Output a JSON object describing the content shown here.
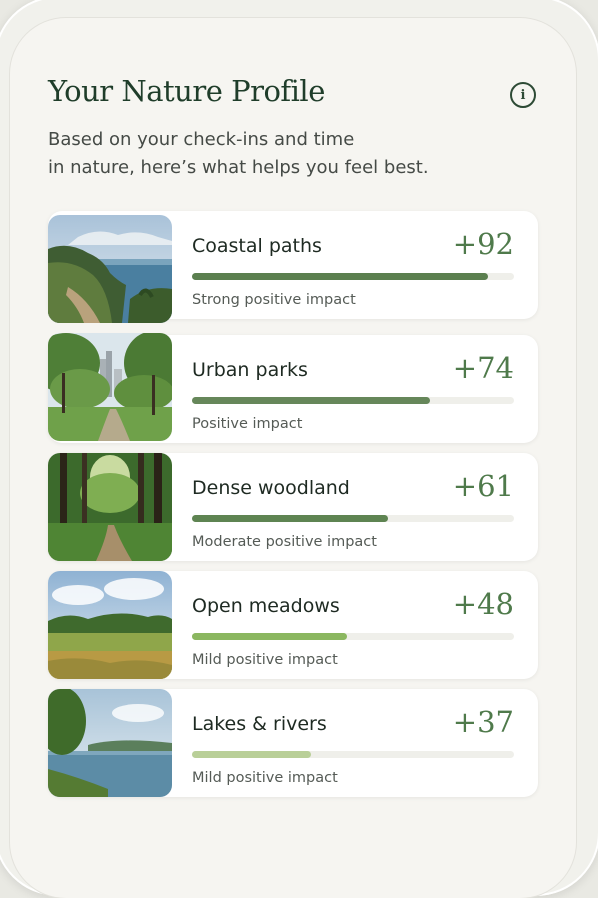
{
  "header": {
    "title": "Your Nature Profile",
    "subtitle_lines": [
      "Based on your check-ins and time",
      "in nature, here’s what helps you feel best."
    ],
    "info_icon": "info-icon"
  },
  "items": [
    {
      "name": "Coastal paths",
      "score": "+92",
      "impact": "Strong positive impact",
      "value": 0.92,
      "bar_color": "#5b7f4f",
      "image": "coastal-cliff-image"
    },
    {
      "name": "Urban parks",
      "score": "+74",
      "impact": "Positive impact",
      "value": 0.74,
      "bar_color": "#66875a",
      "image": "urban-park-image"
    },
    {
      "name": "Dense woodland",
      "score": "+61",
      "impact": "Moderate positive impact",
      "value": 0.61,
      "bar_color": "#5e8452",
      "image": "woodland-image"
    },
    {
      "name": "Open meadows",
      "score": "+48",
      "impact": "Mild positive impact",
      "value": 0.48,
      "bar_color": "#8bb760",
      "image": "meadow-image"
    },
    {
      "name": "Lakes & rivers",
      "score": "+37",
      "impact": "Mild positive impact",
      "value": 0.37,
      "bar_color": "#b9cf98",
      "image": "lake-image"
    }
  ]
}
